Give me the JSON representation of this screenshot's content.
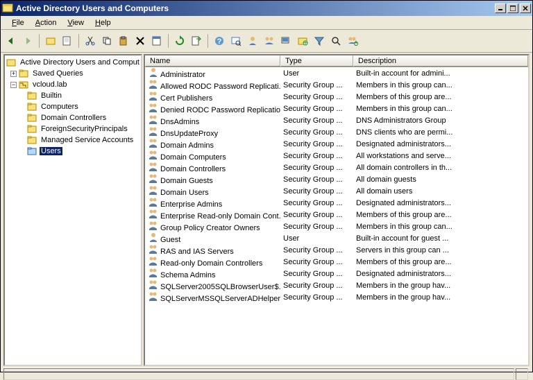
{
  "window": {
    "title": "Active Directory Users and Computers"
  },
  "menu": {
    "file": "File",
    "action": "Action",
    "view": "View",
    "help": "Help"
  },
  "tree": {
    "root": "Active Directory Users and Comput",
    "saved_queries": "Saved Queries",
    "domain": "vcloud.lab",
    "nodes": [
      "Builtin",
      "Computers",
      "Domain Controllers",
      "ForeignSecurityPrincipals",
      "Managed Service Accounts",
      "Users"
    ]
  },
  "columns": {
    "name": "Name",
    "type": "Type",
    "description": "Description"
  },
  "rows": [
    {
      "icon": "user",
      "name": "Administrator",
      "type": "User",
      "desc": "Built-in account for admini..."
    },
    {
      "icon": "group",
      "name": "Allowed RODC Password Replicati...",
      "type": "Security Group ...",
      "desc": "Members in this group can..."
    },
    {
      "icon": "group",
      "name": "Cert Publishers",
      "type": "Security Group ...",
      "desc": "Members of this group are..."
    },
    {
      "icon": "group",
      "name": "Denied RODC Password Replicatio...",
      "type": "Security Group ...",
      "desc": "Members in this group can..."
    },
    {
      "icon": "group",
      "name": "DnsAdmins",
      "type": "Security Group ...",
      "desc": "DNS Administrators Group"
    },
    {
      "icon": "group",
      "name": "DnsUpdateProxy",
      "type": "Security Group ...",
      "desc": "DNS clients who are permi..."
    },
    {
      "icon": "group",
      "name": "Domain Admins",
      "type": "Security Group ...",
      "desc": "Designated administrators..."
    },
    {
      "icon": "group",
      "name": "Domain Computers",
      "type": "Security Group ...",
      "desc": "All workstations and serve..."
    },
    {
      "icon": "group",
      "name": "Domain Controllers",
      "type": "Security Group ...",
      "desc": "All domain controllers in th..."
    },
    {
      "icon": "group",
      "name": "Domain Guests",
      "type": "Security Group ...",
      "desc": "All domain guests"
    },
    {
      "icon": "group",
      "name": "Domain Users",
      "type": "Security Group ...",
      "desc": "All domain users"
    },
    {
      "icon": "group",
      "name": "Enterprise Admins",
      "type": "Security Group ...",
      "desc": "Designated administrators..."
    },
    {
      "icon": "group",
      "name": "Enterprise Read-only Domain Cont...",
      "type": "Security Group ...",
      "desc": "Members of this group are..."
    },
    {
      "icon": "group",
      "name": "Group Policy Creator Owners",
      "type": "Security Group ...",
      "desc": "Members in this group can..."
    },
    {
      "icon": "user",
      "name": "Guest",
      "type": "User",
      "desc": "Built-in account for guest ..."
    },
    {
      "icon": "group",
      "name": "RAS and IAS Servers",
      "type": "Security Group ...",
      "desc": "Servers in this group can ..."
    },
    {
      "icon": "group",
      "name": "Read-only Domain Controllers",
      "type": "Security Group ...",
      "desc": "Members of this group are..."
    },
    {
      "icon": "group",
      "name": "Schema Admins",
      "type": "Security Group ...",
      "desc": "Designated administrators..."
    },
    {
      "icon": "group",
      "name": "SQLServer2005SQLBrowserUser$...",
      "type": "Security Group ...",
      "desc": "Members in the group hav..."
    },
    {
      "icon": "group",
      "name": "SQLServerMSSQLServerADHelper...",
      "type": "Security Group ...",
      "desc": "Members in the group hav..."
    }
  ]
}
